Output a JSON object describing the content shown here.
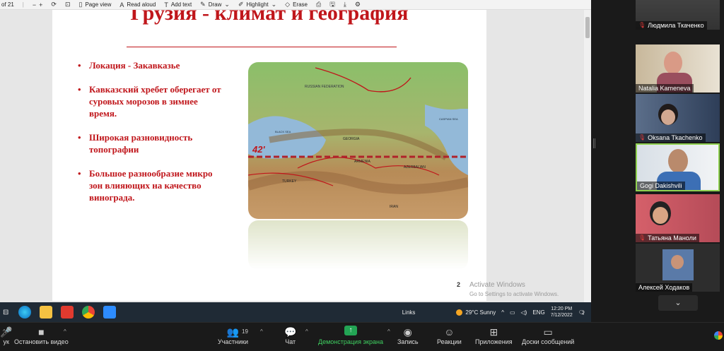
{
  "pdf_toolbar": {
    "page_indicator": "of 21",
    "page_view": "Page view",
    "read_aloud": "Read aloud",
    "add_text": "Add text",
    "draw": "Draw",
    "highlight": "Highlight",
    "erase": "Erase"
  },
  "slide": {
    "title": "Грузия - климат и география",
    "bullets": [
      "Локация  - Закавказье",
      "Кавказский хребет оберегает от суровых морозов в зимнее время.",
      "Широкая разновидность топографии",
      "Большое разнообразие микро зон влияющих на качество винограда."
    ],
    "map_labels": {
      "russia": "RUSSIAN FEDERATION",
      "black_sea": "BLACK SEA",
      "caspian": "CASPIAN SEA",
      "georgia": "GEORGIA",
      "armenia": "ARMENIA",
      "azerbaijan": "AZERBAIJAN",
      "turkey": "TURKEY",
      "iran": "IRAN",
      "latitude": "42'"
    },
    "page_number": "2"
  },
  "watermark": {
    "title": "Activate Windows",
    "subtitle": "Go to Settings to activate Windows."
  },
  "taskbar": {
    "links": "Links",
    "weather": "29°C  Sunny",
    "language": "ENG",
    "time": "12:20 PM",
    "date": "7/12/2022",
    "notifications": "2"
  },
  "participants": [
    {
      "name": "Людмила Ткаченко",
      "muted": true
    },
    {
      "name": "Natalia Kameneva",
      "muted": false
    },
    {
      "name": "Oksana Tkachenko",
      "muted": true
    },
    {
      "name": "Gogi Dakishvili",
      "muted": false,
      "active": true
    },
    {
      "name": "Татьяна Маноли",
      "muted": true
    },
    {
      "name": "Алексей Ходаков",
      "muted": false
    }
  ],
  "zoom_bar": {
    "audio_label": "ук",
    "video_label": "Остановить видео",
    "participants_label": "Участники",
    "participants_count": "19",
    "chat_label": "Чат",
    "share_label": "Демонстрация экрана",
    "record_label": "Запись",
    "reactions_label": "Реакции",
    "apps_label": "Приложения",
    "whiteboard_label": "Доски сообщений"
  },
  "colors": {
    "slide_red": "#c0161b",
    "active_speaker": "#8fd14f",
    "share_green": "#23a454"
  }
}
